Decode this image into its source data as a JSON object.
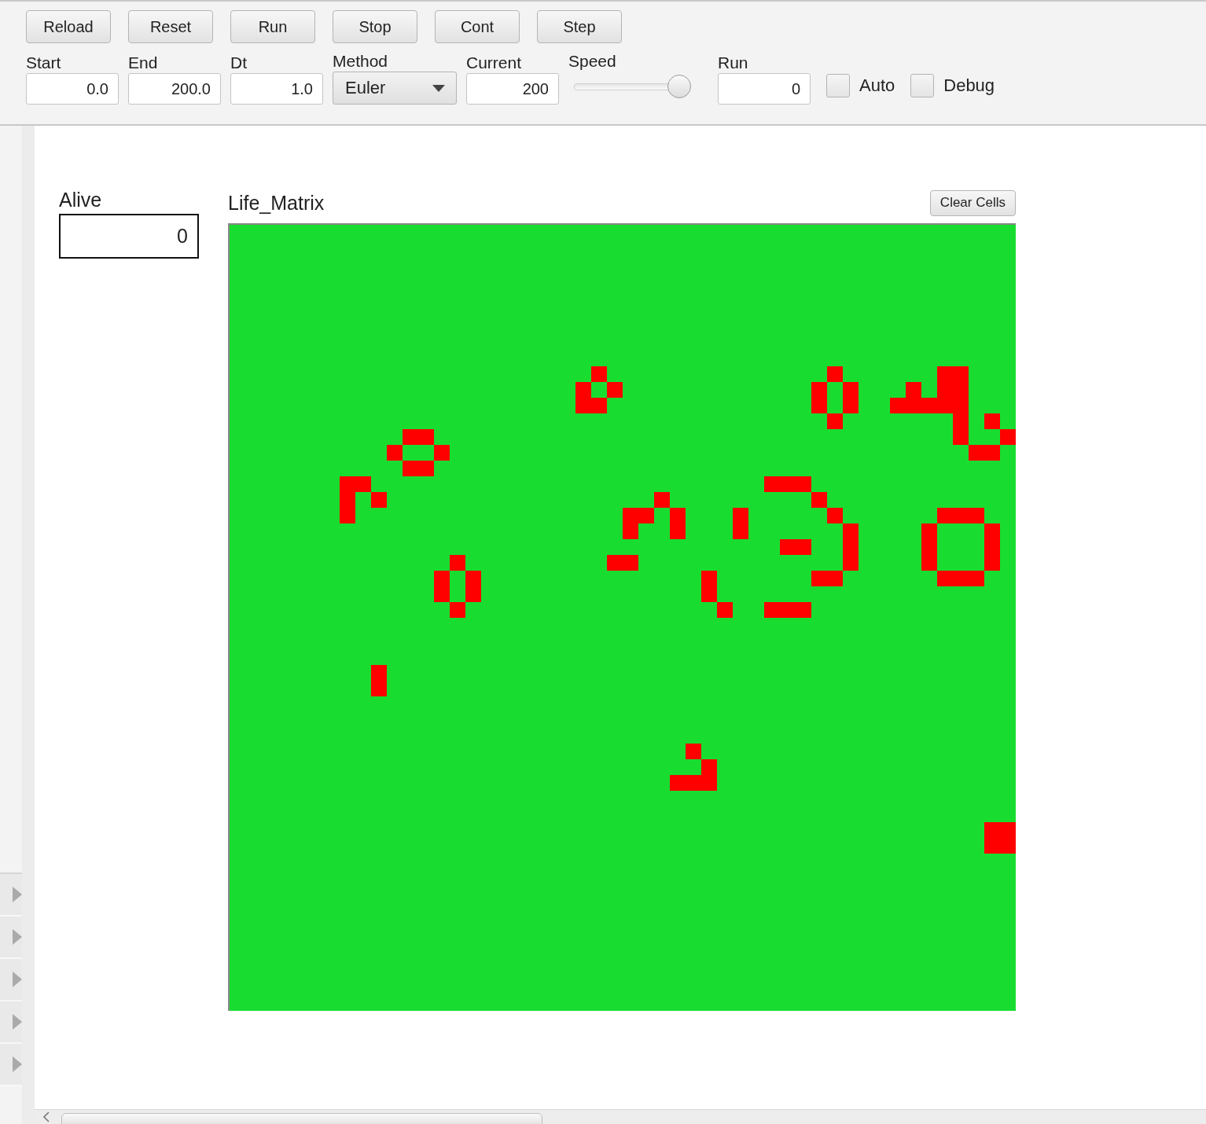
{
  "toolbar": {
    "buttons": [
      "Reload",
      "Reset",
      "Run",
      "Stop",
      "Cont",
      "Step"
    ],
    "fields": [
      {
        "kind": "text",
        "label": "Start",
        "value": "0.0"
      },
      {
        "kind": "text",
        "label": "End",
        "value": "200.0"
      },
      {
        "kind": "text",
        "label": "Dt",
        "value": "1.0"
      },
      {
        "kind": "dropdown",
        "label": "Method",
        "value": "Euler"
      },
      {
        "kind": "text",
        "label": "Current",
        "value": "200"
      },
      {
        "kind": "slider",
        "label": "Speed",
        "level": 1.0
      },
      {
        "kind": "text",
        "label": "Run",
        "value": "0"
      }
    ],
    "checkboxes": [
      {
        "label": "Auto",
        "checked": false
      },
      {
        "label": "Debug",
        "checked": false
      }
    ]
  },
  "side_panel": {
    "items": [
      {
        "expanded": false
      },
      {
        "expanded": false
      },
      {
        "expanded": false
      },
      {
        "expanded": false
      },
      {
        "expanded": false
      }
    ]
  },
  "alive": {
    "label": "Alive",
    "value": "0"
  },
  "life_matrix": {
    "title": "Life_Matrix",
    "button": "Clear Cells",
    "cells": [
      [
        false,
        false,
        false,
        false,
        false,
        false,
        false,
        false,
        false,
        false,
        false,
        false,
        false,
        false,
        false,
        false,
        false,
        false,
        false,
        false,
        false,
        false,
        false,
        false,
        false,
        false,
        false,
        false,
        false,
        false,
        false,
        false,
        false,
        false,
        false,
        false,
        false,
        false,
        false,
        false,
        false,
        false,
        false,
        false,
        false,
        false,
        false,
        false,
        false,
        false
      ],
      [
        false,
        false,
        false,
        false,
        false,
        false,
        false,
        false,
        false,
        false,
        false,
        false,
        false,
        false,
        false,
        false,
        false,
        false,
        false,
        false,
        false,
        false,
        false,
        false,
        false,
        false,
        false,
        false,
        false,
        false,
        false,
        false,
        false,
        false,
        false,
        false,
        false,
        false,
        false,
        false,
        false,
        false,
        false,
        false,
        false,
        false,
        false,
        false,
        false,
        false
      ],
      [
        false,
        false,
        false,
        false,
        false,
        false,
        false,
        false,
        false,
        false,
        false,
        false,
        false,
        false,
        false,
        false,
        false,
        false,
        false,
        false,
        false,
        false,
        false,
        false,
        false,
        false,
        false,
        false,
        false,
        false,
        false,
        false,
        false,
        false,
        false,
        false,
        false,
        false,
        false,
        false,
        false,
        false,
        false,
        false,
        false,
        false,
        false,
        false,
        false,
        false
      ],
      [
        false,
        false,
        false,
        false,
        false,
        false,
        false,
        false,
        false,
        false,
        false,
        false,
        false,
        false,
        false,
        false,
        false,
        false,
        false,
        false,
        false,
        false,
        false,
        false,
        false,
        false,
        false,
        false,
        false,
        false,
        false,
        false,
        false,
        false,
        false,
        false,
        false,
        false,
        false,
        false,
        false,
        false,
        false,
        false,
        false,
        false,
        false,
        false,
        false,
        false
      ],
      [
        false,
        false,
        false,
        false,
        false,
        false,
        false,
        false,
        false,
        false,
        false,
        false,
        false,
        false,
        false,
        false,
        false,
        false,
        false,
        false,
        false,
        false,
        false,
        false,
        false,
        false,
        false,
        false,
        false,
        false,
        false,
        false,
        false,
        false,
        false,
        false,
        false,
        false,
        false,
        false,
        false,
        false,
        false,
        false,
        false,
        false,
        false,
        false,
        false,
        false
      ],
      [
        false,
        false,
        false,
        false,
        false,
        false,
        false,
        false,
        false,
        false,
        false,
        false,
        false,
        false,
        false,
        false,
        false,
        false,
        false,
        false,
        false,
        false,
        false,
        false,
        false,
        false,
        false,
        false,
        false,
        false,
        false,
        false,
        false,
        false,
        false,
        false,
        false,
        false,
        false,
        false,
        false,
        false,
        false,
        false,
        false,
        false,
        false,
        false,
        false,
        false
      ],
      [
        false,
        false,
        false,
        false,
        false,
        false,
        false,
        false,
        false,
        false,
        false,
        false,
        false,
        false,
        false,
        false,
        false,
        false,
        false,
        false,
        false,
        false,
        false,
        false,
        false,
        false,
        false,
        false,
        false,
        false,
        false,
        false,
        false,
        false,
        false,
        false,
        false,
        false,
        false,
        false,
        false,
        false,
        false,
        false,
        false,
        false,
        false,
        false,
        false,
        false
      ],
      [
        false,
        false,
        false,
        false,
        false,
        false,
        false,
        false,
        false,
        false,
        false,
        false,
        false,
        false,
        false,
        false,
        false,
        false,
        false,
        false,
        false,
        false,
        false,
        false,
        false,
        false,
        false,
        false,
        false,
        false,
        false,
        false,
        false,
        false,
        false,
        false,
        false,
        false,
        false,
        false,
        false,
        false,
        false,
        false,
        false,
        false,
        false,
        false,
        false,
        false
      ],
      [
        false,
        false,
        false,
        false,
        false,
        false,
        false,
        false,
        false,
        false,
        false,
        false,
        false,
        false,
        false,
        false,
        false,
        false,
        false,
        false,
        false,
        false,
        false,
        false,
        false,
        false,
        false,
        false,
        false,
        false,
        false,
        false,
        false,
        false,
        false,
        false,
        false,
        false,
        false,
        false,
        false,
        false,
        false,
        false,
        false,
        false,
        false,
        false,
        false,
        false
      ],
      [
        false,
        false,
        false,
        false,
        false,
        false,
        false,
        false,
        false,
        false,
        false,
        false,
        false,
        false,
        false,
        false,
        false,
        false,
        false,
        false,
        false,
        false,
        false,
        true,
        false,
        false,
        false,
        false,
        false,
        false,
        false,
        false,
        false,
        false,
        false,
        false,
        false,
        false,
        true,
        false,
        false,
        false,
        false,
        false,
        false,
        true,
        true,
        false,
        false,
        false
      ],
      [
        false,
        false,
        false,
        false,
        false,
        false,
        false,
        false,
        false,
        false,
        false,
        false,
        false,
        false,
        false,
        false,
        false,
        false,
        false,
        false,
        false,
        false,
        true,
        false,
        true,
        false,
        false,
        false,
        false,
        false,
        false,
        false,
        false,
        false,
        false,
        false,
        false,
        true,
        false,
        true,
        false,
        false,
        false,
        true,
        false,
        true,
        true,
        false,
        false,
        false
      ],
      [
        false,
        false,
        false,
        false,
        false,
        false,
        false,
        false,
        false,
        false,
        false,
        false,
        false,
        false,
        false,
        false,
        false,
        false,
        false,
        false,
        false,
        false,
        true,
        true,
        false,
        false,
        false,
        false,
        false,
        false,
        false,
        false,
        false,
        false,
        false,
        false,
        false,
        true,
        false,
        true,
        false,
        false,
        true,
        true,
        true,
        true,
        true,
        false,
        false,
        false
      ],
      [
        false,
        false,
        false,
        false,
        false,
        false,
        false,
        false,
        false,
        false,
        false,
        false,
        false,
        false,
        false,
        false,
        false,
        false,
        false,
        false,
        false,
        false,
        false,
        false,
        false,
        false,
        false,
        false,
        false,
        false,
        false,
        false,
        false,
        false,
        false,
        false,
        false,
        false,
        true,
        false,
        false,
        false,
        false,
        false,
        false,
        false,
        true,
        false,
        true,
        false
      ],
      [
        false,
        false,
        false,
        false,
        false,
        false,
        false,
        false,
        false,
        false,
        false,
        true,
        true,
        false,
        false,
        false,
        false,
        false,
        false,
        false,
        false,
        false,
        false,
        false,
        false,
        false,
        false,
        false,
        false,
        false,
        false,
        false,
        false,
        false,
        false,
        false,
        false,
        false,
        false,
        false,
        false,
        false,
        false,
        false,
        false,
        false,
        true,
        false,
        false,
        true
      ],
      [
        false,
        false,
        false,
        false,
        false,
        false,
        false,
        false,
        false,
        false,
        true,
        false,
        false,
        true,
        false,
        false,
        false,
        false,
        false,
        false,
        false,
        false,
        false,
        false,
        false,
        false,
        false,
        false,
        false,
        false,
        false,
        false,
        false,
        false,
        false,
        false,
        false,
        false,
        false,
        false,
        false,
        false,
        false,
        false,
        false,
        false,
        false,
        true,
        true,
        false
      ],
      [
        false,
        false,
        false,
        false,
        false,
        false,
        false,
        false,
        false,
        false,
        false,
        true,
        true,
        false,
        false,
        false,
        false,
        false,
        false,
        false,
        false,
        false,
        false,
        false,
        false,
        false,
        false,
        false,
        false,
        false,
        false,
        false,
        false,
        false,
        false,
        false,
        false,
        false,
        false,
        false,
        false,
        false,
        false,
        false,
        false,
        false,
        false,
        false,
        false,
        false
      ],
      [
        false,
        false,
        false,
        false,
        false,
        false,
        false,
        true,
        true,
        false,
        false,
        false,
        false,
        false,
        false,
        false,
        false,
        false,
        false,
        false,
        false,
        false,
        false,
        false,
        false,
        false,
        false,
        false,
        false,
        false,
        false,
        false,
        false,
        false,
        true,
        true,
        true,
        false,
        false,
        false,
        false,
        false,
        false,
        false,
        false,
        false,
        false,
        false,
        false,
        false
      ],
      [
        false,
        false,
        false,
        false,
        false,
        false,
        false,
        true,
        false,
        true,
        false,
        false,
        false,
        false,
        false,
        false,
        false,
        false,
        false,
        false,
        false,
        false,
        false,
        false,
        false,
        false,
        false,
        true,
        false,
        false,
        false,
        false,
        false,
        false,
        false,
        false,
        false,
        true,
        false,
        false,
        false,
        false,
        false,
        false,
        false,
        false,
        false,
        false,
        false,
        false
      ],
      [
        false,
        false,
        false,
        false,
        false,
        false,
        false,
        true,
        false,
        false,
        false,
        false,
        false,
        false,
        false,
        false,
        false,
        false,
        false,
        false,
        false,
        false,
        false,
        false,
        false,
        true,
        true,
        false,
        true,
        false,
        false,
        false,
        true,
        false,
        false,
        false,
        false,
        false,
        true,
        false,
        false,
        false,
        false,
        false,
        false,
        true,
        true,
        true,
        false,
        false
      ],
      [
        false,
        false,
        false,
        false,
        false,
        false,
        false,
        false,
        false,
        false,
        false,
        false,
        false,
        false,
        false,
        false,
        false,
        false,
        false,
        false,
        false,
        false,
        false,
        false,
        false,
        true,
        false,
        false,
        true,
        false,
        false,
        false,
        true,
        false,
        false,
        false,
        false,
        false,
        false,
        true,
        false,
        false,
        false,
        false,
        true,
        false,
        false,
        false,
        true,
        false
      ],
      [
        false,
        false,
        false,
        false,
        false,
        false,
        false,
        false,
        false,
        false,
        false,
        false,
        false,
        false,
        false,
        false,
        false,
        false,
        false,
        false,
        false,
        false,
        false,
        false,
        false,
        false,
        false,
        false,
        false,
        false,
        false,
        false,
        false,
        false,
        false,
        true,
        true,
        false,
        false,
        true,
        false,
        false,
        false,
        false,
        true,
        false,
        false,
        false,
        true,
        false
      ],
      [
        false,
        false,
        false,
        false,
        false,
        false,
        false,
        false,
        false,
        false,
        false,
        false,
        false,
        false,
        true,
        false,
        false,
        false,
        false,
        false,
        false,
        false,
        false,
        false,
        true,
        true,
        false,
        false,
        false,
        false,
        false,
        false,
        false,
        false,
        false,
        false,
        false,
        false,
        false,
        true,
        false,
        false,
        false,
        false,
        true,
        false,
        false,
        false,
        true,
        false
      ],
      [
        false,
        false,
        false,
        false,
        false,
        false,
        false,
        false,
        false,
        false,
        false,
        false,
        false,
        true,
        false,
        true,
        false,
        false,
        false,
        false,
        false,
        false,
        false,
        false,
        false,
        false,
        false,
        false,
        false,
        false,
        true,
        false,
        false,
        false,
        false,
        false,
        false,
        true,
        true,
        false,
        false,
        false,
        false,
        false,
        false,
        true,
        true,
        true,
        false,
        false
      ],
      [
        false,
        false,
        false,
        false,
        false,
        false,
        false,
        false,
        false,
        false,
        false,
        false,
        false,
        true,
        false,
        true,
        false,
        false,
        false,
        false,
        false,
        false,
        false,
        false,
        false,
        false,
        false,
        false,
        false,
        false,
        true,
        false,
        false,
        false,
        false,
        false,
        false,
        false,
        false,
        false,
        false,
        false,
        false,
        false,
        false,
        false,
        false,
        false,
        false,
        false
      ],
      [
        false,
        false,
        false,
        false,
        false,
        false,
        false,
        false,
        false,
        false,
        false,
        false,
        false,
        false,
        true,
        false,
        false,
        false,
        false,
        false,
        false,
        false,
        false,
        false,
        false,
        false,
        false,
        false,
        false,
        false,
        false,
        true,
        false,
        false,
        true,
        true,
        true,
        false,
        false,
        false,
        false,
        false,
        false,
        false,
        false,
        false,
        false,
        false,
        false,
        false
      ],
      [
        false,
        false,
        false,
        false,
        false,
        false,
        false,
        false,
        false,
        false,
        false,
        false,
        false,
        false,
        false,
        false,
        false,
        false,
        false,
        false,
        false,
        false,
        false,
        false,
        false,
        false,
        false,
        false,
        false,
        false,
        false,
        false,
        false,
        false,
        false,
        false,
        false,
        false,
        false,
        false,
        false,
        false,
        false,
        false,
        false,
        false,
        false,
        false,
        false,
        false
      ],
      [
        false,
        false,
        false,
        false,
        false,
        false,
        false,
        false,
        false,
        false,
        false,
        false,
        false,
        false,
        false,
        false,
        false,
        false,
        false,
        false,
        false,
        false,
        false,
        false,
        false,
        false,
        false,
        false,
        false,
        false,
        false,
        false,
        false,
        false,
        false,
        false,
        false,
        false,
        false,
        false,
        false,
        false,
        false,
        false,
        false,
        false,
        false,
        false,
        false,
        false
      ],
      [
        false,
        false,
        false,
        false,
        false,
        false,
        false,
        false,
        false,
        false,
        false,
        false,
        false,
        false,
        false,
        false,
        false,
        false,
        false,
        false,
        false,
        false,
        false,
        false,
        false,
        false,
        false,
        false,
        false,
        false,
        false,
        false,
        false,
        false,
        false,
        false,
        false,
        false,
        false,
        false,
        false,
        false,
        false,
        false,
        false,
        false,
        false,
        false,
        false,
        false
      ],
      [
        false,
        false,
        false,
        false,
        false,
        false,
        false,
        false,
        false,
        true,
        false,
        false,
        false,
        false,
        false,
        false,
        false,
        false,
        false,
        false,
        false,
        false,
        false,
        false,
        false,
        false,
        false,
        false,
        false,
        false,
        false,
        false,
        false,
        false,
        false,
        false,
        false,
        false,
        false,
        false,
        false,
        false,
        false,
        false,
        false,
        false,
        false,
        false,
        false,
        false
      ],
      [
        false,
        false,
        false,
        false,
        false,
        false,
        false,
        false,
        false,
        true,
        false,
        false,
        false,
        false,
        false,
        false,
        false,
        false,
        false,
        false,
        false,
        false,
        false,
        false,
        false,
        false,
        false,
        false,
        false,
        false,
        false,
        false,
        false,
        false,
        false,
        false,
        false,
        false,
        false,
        false,
        false,
        false,
        false,
        false,
        false,
        false,
        false,
        false,
        false,
        false
      ],
      [
        false,
        false,
        false,
        false,
        false,
        false,
        false,
        false,
        false,
        false,
        false,
        false,
        false,
        false,
        false,
        false,
        false,
        false,
        false,
        false,
        false,
        false,
        false,
        false,
        false,
        false,
        false,
        false,
        false,
        false,
        false,
        false,
        false,
        false,
        false,
        false,
        false,
        false,
        false,
        false,
        false,
        false,
        false,
        false,
        false,
        false,
        false,
        false,
        false,
        false
      ],
      [
        false,
        false,
        false,
        false,
        false,
        false,
        false,
        false,
        false,
        false,
        false,
        false,
        false,
        false,
        false,
        false,
        false,
        false,
        false,
        false,
        false,
        false,
        false,
        false,
        false,
        false,
        false,
        false,
        false,
        false,
        false,
        false,
        false,
        false,
        false,
        false,
        false,
        false,
        false,
        false,
        false,
        false,
        false,
        false,
        false,
        false,
        false,
        false,
        false,
        false
      ],
      [
        false,
        false,
        false,
        false,
        false,
        false,
        false,
        false,
        false,
        false,
        false,
        false,
        false,
        false,
        false,
        false,
        false,
        false,
        false,
        false,
        false,
        false,
        false,
        false,
        false,
        false,
        false,
        false,
        false,
        false,
        false,
        false,
        false,
        false,
        false,
        false,
        false,
        false,
        false,
        false,
        false,
        false,
        false,
        false,
        false,
        false,
        false,
        false,
        false,
        false
      ],
      [
        false,
        false,
        false,
        false,
        false,
        false,
        false,
        false,
        false,
        false,
        false,
        false,
        false,
        false,
        false,
        false,
        false,
        false,
        false,
        false,
        false,
        false,
        false,
        false,
        false,
        false,
        false,
        false,
        false,
        true,
        false,
        false,
        false,
        false,
        false,
        false,
        false,
        false,
        false,
        false,
        false,
        false,
        false,
        false,
        false,
        false,
        false,
        false,
        false,
        false
      ],
      [
        false,
        false,
        false,
        false,
        false,
        false,
        false,
        false,
        false,
        false,
        false,
        false,
        false,
        false,
        false,
        false,
        false,
        false,
        false,
        false,
        false,
        false,
        false,
        false,
        false,
        false,
        false,
        false,
        false,
        false,
        true,
        false,
        false,
        false,
        false,
        false,
        false,
        false,
        false,
        false,
        false,
        false,
        false,
        false,
        false,
        false,
        false,
        false,
        false,
        false
      ],
      [
        false,
        false,
        false,
        false,
        false,
        false,
        false,
        false,
        false,
        false,
        false,
        false,
        false,
        false,
        false,
        false,
        false,
        false,
        false,
        false,
        false,
        false,
        false,
        false,
        false,
        false,
        false,
        false,
        true,
        true,
        true,
        false,
        false,
        false,
        false,
        false,
        false,
        false,
        false,
        false,
        false,
        false,
        false,
        false,
        false,
        false,
        false,
        false,
        false,
        false
      ],
      [
        false,
        false,
        false,
        false,
        false,
        false,
        false,
        false,
        false,
        false,
        false,
        false,
        false,
        false,
        false,
        false,
        false,
        false,
        false,
        false,
        false,
        false,
        false,
        false,
        false,
        false,
        false,
        false,
        false,
        false,
        false,
        false,
        false,
        false,
        false,
        false,
        false,
        false,
        false,
        false,
        false,
        false,
        false,
        false,
        false,
        false,
        false,
        false,
        false,
        false
      ],
      [
        false,
        false,
        false,
        false,
        false,
        false,
        false,
        false,
        false,
        false,
        false,
        false,
        false,
        false,
        false,
        false,
        false,
        false,
        false,
        false,
        false,
        false,
        false,
        false,
        false,
        false,
        false,
        false,
        false,
        false,
        false,
        false,
        false,
        false,
        false,
        false,
        false,
        false,
        false,
        false,
        false,
        false,
        false,
        false,
        false,
        false,
        false,
        false,
        false,
        false
      ],
      [
        false,
        false,
        false,
        false,
        false,
        false,
        false,
        false,
        false,
        false,
        false,
        false,
        false,
        false,
        false,
        false,
        false,
        false,
        false,
        false,
        false,
        false,
        false,
        false,
        false,
        false,
        false,
        false,
        false,
        false,
        false,
        false,
        false,
        false,
        false,
        false,
        false,
        false,
        false,
        false,
        false,
        false,
        false,
        false,
        false,
        false,
        false,
        false,
        true,
        true
      ],
      [
        false,
        false,
        false,
        false,
        false,
        false,
        false,
        false,
        false,
        false,
        false,
        false,
        false,
        false,
        false,
        false,
        false,
        false,
        false,
        false,
        false,
        false,
        false,
        false,
        false,
        false,
        false,
        false,
        false,
        false,
        false,
        false,
        false,
        false,
        false,
        false,
        false,
        false,
        false,
        false,
        false,
        false,
        false,
        false,
        false,
        false,
        false,
        false,
        true,
        true
      ],
      [
        false,
        false,
        false,
        false,
        false,
        false,
        false,
        false,
        false,
        false,
        false,
        false,
        false,
        false,
        false,
        false,
        false,
        false,
        false,
        false,
        false,
        false,
        false,
        false,
        false,
        false,
        false,
        false,
        false,
        false,
        false,
        false,
        false,
        false,
        false,
        false,
        false,
        false,
        false,
        false,
        false,
        false,
        false,
        false,
        false,
        false,
        false,
        false,
        false,
        false
      ],
      [
        false,
        false,
        false,
        false,
        false,
        false,
        false,
        false,
        false,
        false,
        false,
        false,
        false,
        false,
        false,
        false,
        false,
        false,
        false,
        false,
        false,
        false,
        false,
        false,
        false,
        false,
        false,
        false,
        false,
        false,
        false,
        false,
        false,
        false,
        false,
        false,
        false,
        false,
        false,
        false,
        false,
        false,
        false,
        false,
        false,
        false,
        false,
        false,
        false,
        false
      ],
      [
        false,
        false,
        false,
        false,
        false,
        false,
        false,
        false,
        false,
        false,
        false,
        false,
        false,
        false,
        false,
        false,
        false,
        false,
        false,
        false,
        false,
        false,
        false,
        false,
        false,
        false,
        false,
        false,
        false,
        false,
        false,
        false,
        false,
        false,
        false,
        false,
        false,
        false,
        false,
        false,
        false,
        false,
        false,
        false,
        false,
        false,
        false,
        false,
        false,
        false
      ],
      [
        false,
        false,
        false,
        false,
        false,
        false,
        false,
        false,
        false,
        false,
        false,
        false,
        false,
        false,
        false,
        false,
        false,
        false,
        false,
        false,
        false,
        false,
        false,
        false,
        false,
        false,
        false,
        false,
        false,
        false,
        false,
        false,
        false,
        false,
        false,
        false,
        false,
        false,
        false,
        false,
        false,
        false,
        false,
        false,
        false,
        false,
        false,
        false,
        false,
        false
      ],
      [
        false,
        false,
        false,
        false,
        false,
        false,
        false,
        false,
        false,
        false,
        false,
        false,
        false,
        false,
        false,
        false,
        false,
        false,
        false,
        false,
        false,
        false,
        false,
        false,
        false,
        false,
        false,
        false,
        false,
        false,
        false,
        false,
        false,
        false,
        false,
        false,
        false,
        false,
        false,
        false,
        false,
        false,
        false,
        false,
        false,
        false,
        false,
        false,
        false,
        false
      ],
      [
        false,
        false,
        false,
        false,
        false,
        false,
        false,
        false,
        false,
        false,
        false,
        false,
        false,
        false,
        false,
        false,
        false,
        false,
        false,
        false,
        false,
        false,
        false,
        false,
        false,
        false,
        false,
        false,
        false,
        false,
        false,
        false,
        false,
        false,
        false,
        false,
        false,
        false,
        false,
        false,
        false,
        false,
        false,
        false,
        false,
        false,
        false,
        false,
        false,
        false
      ],
      [
        false,
        false,
        false,
        false,
        false,
        false,
        false,
        false,
        false,
        false,
        false,
        false,
        false,
        false,
        false,
        false,
        false,
        false,
        false,
        false,
        false,
        false,
        false,
        false,
        false,
        false,
        false,
        false,
        false,
        false,
        false,
        false,
        false,
        false,
        false,
        false,
        false,
        false,
        false,
        false,
        false,
        false,
        false,
        false,
        false,
        false,
        false,
        false,
        false,
        false
      ],
      [
        false,
        false,
        false,
        false,
        false,
        false,
        false,
        false,
        false,
        false,
        false,
        false,
        false,
        false,
        false,
        false,
        false,
        false,
        false,
        false,
        false,
        false,
        false,
        false,
        false,
        false,
        false,
        false,
        false,
        false,
        false,
        false,
        false,
        false,
        false,
        false,
        false,
        false,
        false,
        false,
        false,
        false,
        false,
        false,
        false,
        false,
        false,
        false,
        false,
        false
      ],
      [
        false,
        false,
        false,
        false,
        false,
        false,
        false,
        false,
        false,
        false,
        false,
        false,
        false,
        false,
        false,
        false,
        false,
        false,
        false,
        false,
        false,
        false,
        false,
        false,
        false,
        false,
        false,
        false,
        false,
        false,
        false,
        false,
        false,
        false,
        false,
        false,
        false,
        false,
        false,
        false,
        false,
        false,
        false,
        false,
        false,
        false,
        false,
        false,
        false,
        false
      ],
      [
        false,
        false,
        false,
        false,
        false,
        false,
        false,
        false,
        false,
        false,
        false,
        false,
        false,
        false,
        false,
        false,
        false,
        false,
        false,
        false,
        false,
        false,
        false,
        false,
        false,
        false,
        false,
        false,
        false,
        false,
        false,
        false,
        false,
        false,
        false,
        false,
        false,
        false,
        false,
        false,
        false,
        false,
        false,
        false,
        false,
        false,
        false,
        false,
        false,
        false
      ]
    ]
  }
}
